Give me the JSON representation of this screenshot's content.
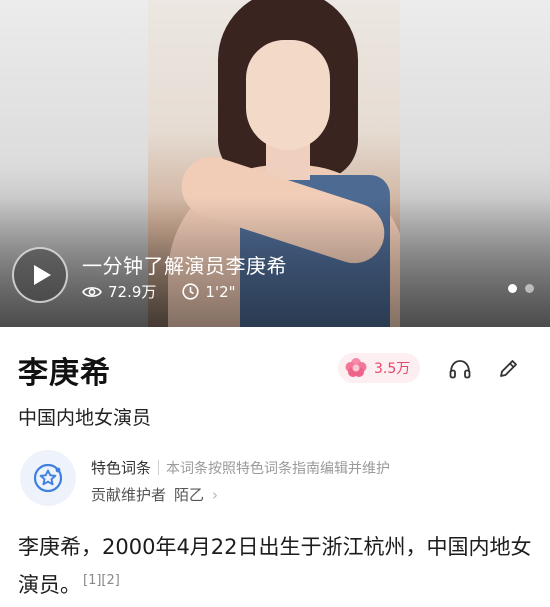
{
  "video": {
    "title": "一分钟了解演员李庚希",
    "views": "72.9万",
    "duration": "1'2\""
  },
  "entry": {
    "name": "李庚希",
    "like_count": "3.5万",
    "description": "中国内地女演员"
  },
  "feature": {
    "tag": "特色词条",
    "note": "本词条按照特色词条指南编辑并维护",
    "maintainer_label": "贡献维护者",
    "maintainer_name": "陌乙",
    "chevron": "›"
  },
  "summary": {
    "line": "李庚希，2000年4月22日出生于浙江杭州，中国内地女演员。",
    "citations": "[1][2]"
  },
  "colors": {
    "accent_pink": "#e8476a",
    "pill_bg": "#fdeff1",
    "feature_icon_blue": "#3f7fe0"
  },
  "icons": [
    "play-icon",
    "eye-icon",
    "clock-icon",
    "flower-icon",
    "headphones-icon",
    "edit-icon",
    "feature-badge-icon"
  ]
}
